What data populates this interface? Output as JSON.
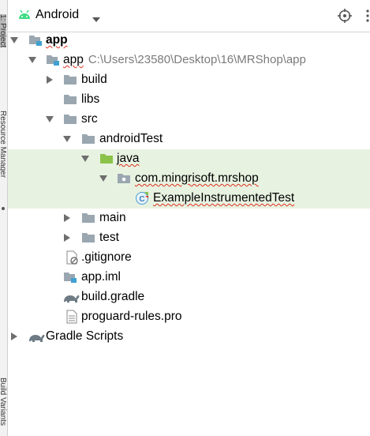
{
  "header": {
    "title": "Android",
    "icons": [
      "android-icon",
      "chevron-down-icon",
      "target-icon",
      "more-icon"
    ]
  },
  "side_tabs": [
    "1: Project",
    "Resource Manager",
    "Build Variants"
  ],
  "tree": [
    {
      "label": "app",
      "path": "",
      "icon": "module-icon",
      "arrow": "expanded"
    },
    {
      "label": "app",
      "path": "C:\\Users\\23580\\Desktop\\16\\MRShop\\app",
      "icon": "module-icon",
      "arrow": "expanded"
    },
    {
      "label": "build",
      "path": "",
      "icon": "folder-icon",
      "arrow": "collapsed"
    },
    {
      "label": "libs",
      "path": "",
      "icon": "folder-icon",
      "arrow": "none"
    },
    {
      "label": "src",
      "path": "",
      "icon": "folder-icon",
      "arrow": "expanded"
    },
    {
      "label": "androidTest",
      "path": "",
      "icon": "folder-icon",
      "arrow": "expanded"
    },
    {
      "label": "java",
      "path": "",
      "icon": "source-folder-icon",
      "arrow": "expanded"
    },
    {
      "label": "com.mingrisoft.mrshop",
      "path": "",
      "icon": "package-icon",
      "arrow": "expanded"
    },
    {
      "label": "ExampleInstrumentedTest",
      "path": "",
      "icon": "class-icon",
      "arrow": "none"
    },
    {
      "label": "main",
      "path": "",
      "icon": "folder-icon",
      "arrow": "collapsed"
    },
    {
      "label": "test",
      "path": "",
      "icon": "folder-icon",
      "arrow": "collapsed"
    },
    {
      "label": ".gitignore",
      "path": "",
      "icon": "ignore-file-icon",
      "arrow": "none"
    },
    {
      "label": "app.iml",
      "path": "",
      "icon": "iml-file-icon",
      "arrow": "none"
    },
    {
      "label": "build.gradle",
      "path": "",
      "icon": "gradle-icon",
      "arrow": "none"
    },
    {
      "label": "proguard-rules.pro",
      "path": "",
      "icon": "text-file-icon",
      "arrow": "none"
    },
    {
      "label": "Gradle Scripts",
      "path": "",
      "icon": "gradle-icon",
      "arrow": "collapsed"
    }
  ],
  "colors": {
    "selection": "#e8f2e1",
    "folder": "#9aa7b0",
    "source_folder": "#8bc34a",
    "android": "#3ddc84",
    "module_square": "#40a0d0"
  }
}
